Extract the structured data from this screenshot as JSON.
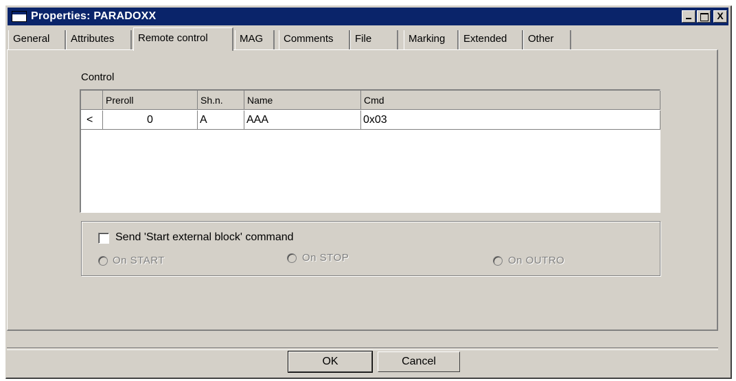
{
  "window": {
    "title": "Properties: PARADOXX",
    "minimize_icon": "minimize-icon",
    "maximize_icon": "maximize-icon",
    "close_glyph": "X"
  },
  "tabs": [
    {
      "label": "General"
    },
    {
      "label": "Attributes"
    },
    {
      "label": "Remote control",
      "active": true
    },
    {
      "label": "MAG"
    },
    {
      "label": "Comments"
    },
    {
      "label": "File"
    },
    {
      "label": "Marking"
    },
    {
      "label": "Extended"
    },
    {
      "label": "Other"
    }
  ],
  "control": {
    "group_label": "Control",
    "columns": [
      "Preroll",
      "Sh.n.",
      "Name",
      "Cmd"
    ],
    "rows": [
      {
        "marker": "<",
        "preroll": "0",
        "shn": "A",
        "name": "AAA",
        "cmd": "0x03"
      }
    ]
  },
  "external_block": {
    "checkbox_label": "Send 'Start external block' command",
    "checked": false,
    "radios": [
      "On START",
      "On STOP",
      "On OUTRO"
    ],
    "radios_enabled": false
  },
  "buttons": {
    "ok": "OK",
    "cancel": "Cancel"
  }
}
